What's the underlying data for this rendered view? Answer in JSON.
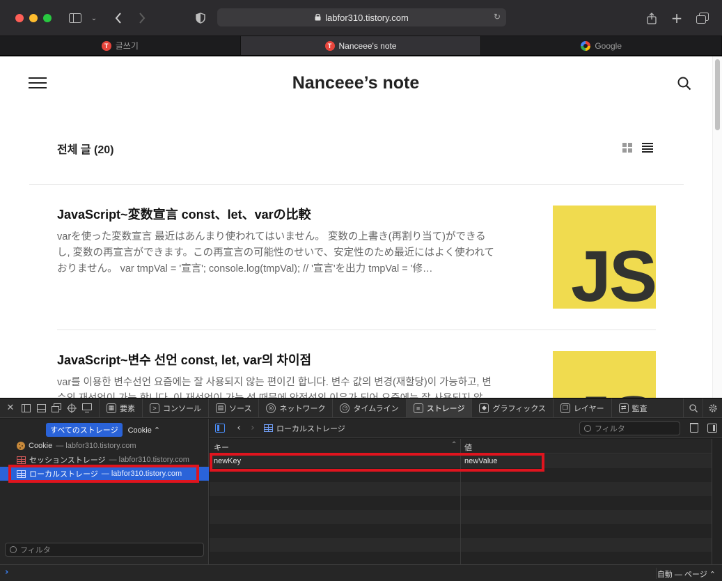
{
  "browser": {
    "url": "labfor310.tistory.com",
    "tabs": [
      {
        "label": "글쓰기",
        "favicon": "tistory-icon"
      },
      {
        "label": "Nanceee's note",
        "favicon": "tistory-icon"
      },
      {
        "label": "Google",
        "favicon": "google-icon"
      }
    ]
  },
  "page": {
    "site_title": "Nanceee’s note",
    "count_label": "전체 글 (20)",
    "posts": [
      {
        "title": "JavaScript~変数宣言 const、let、varの比較",
        "excerpt": "varを使った変数宣言 最近はあんまり使われてはいません。 変数の上書き(再割り当て)ができるし, 変数の再宣言ができます。この再宣言の可能性のせいで、安定性のため最近にはよく使われておりません。 var tmpVal = '宣言'; console.log(tmpVal); // '宣言'を出力 tmpVal = '修…",
        "thumb_text": "JS"
      },
      {
        "title": "JavaScript~변수 선언 const, let, var의 차이점",
        "excerpt": "var를 이용한 변수선언 요즘에는 잘 사용되지 않는 편이긴 합니다. 변수 값의 변경(재할당)이 가능하고, 변수의 재선언이 가능 합니다. 이 재선언이 가능 성 때문에 안정성의 이유가 되어 요즘에는 잘 사용되지 않",
        "thumb_text": "JS"
      }
    ]
  },
  "inspector": {
    "tabs": [
      "要素",
      "コンソール",
      "ソース",
      "ネットワーク",
      "タイムライン",
      "ストレージ",
      "グラフィックス",
      "レイヤー",
      "監査"
    ],
    "active_tab": "ストレージ",
    "scope_pill": "すべてのストレージ",
    "scope_select": "Cookie",
    "tree": [
      {
        "label": "Cookie",
        "domain": "— labfor310.tistory.com",
        "icon": "cookie-icon"
      },
      {
        "label": "セッションストレージ",
        "domain": "— labfor310.tistory.com",
        "icon": "table-icon"
      },
      {
        "label": "ローカルストレージ",
        "domain": "— labfor310.tistory.com",
        "icon": "table-icon"
      }
    ],
    "left_filter_placeholder": "フィルタ",
    "breadcrumb": "ローカルストレージ",
    "right_filter_placeholder": "フィルタ",
    "columns": {
      "key": "キー",
      "value": "値"
    },
    "rows": [
      {
        "key": "newKey",
        "value": "newValue"
      }
    ],
    "console_context": "自動 — ページ"
  },
  "colors": {
    "accent": "#2a63d9",
    "highlight": "#e0141e",
    "js_yellow": "#f0db4f"
  }
}
